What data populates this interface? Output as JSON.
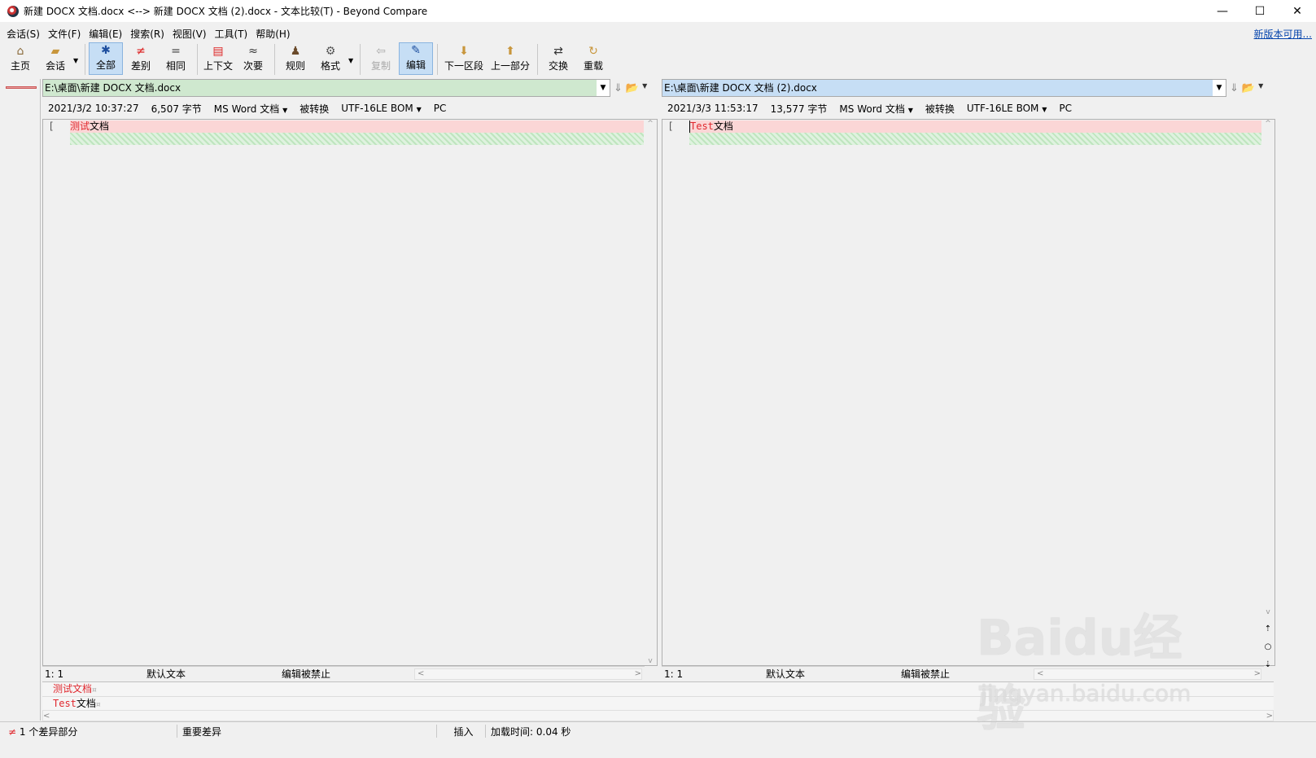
{
  "window": {
    "title": "新建 DOCX 文档.docx <--> 新建 DOCX 文档 (2).docx - 文本比较(T) - Beyond Compare",
    "minimize": "—",
    "maximize": "☐",
    "close": "✕"
  },
  "menu": {
    "items": [
      "会话(S)",
      "文件(F)",
      "编辑(E)",
      "搜索(R)",
      "视图(V)",
      "工具(T)",
      "帮助(H)"
    ],
    "new_version": "新版本可用..."
  },
  "toolbar": {
    "home": "主页",
    "session": "会话",
    "all": "全部",
    "diffs": "差别",
    "same": "相同",
    "context": "上下文",
    "minor": "次要",
    "rules": "规则",
    "format": "格式",
    "copy": "复制",
    "edit": "编辑",
    "next_section": "下一区段",
    "prev_section": "上一部分",
    "swap": "交换",
    "reload": "重载"
  },
  "left": {
    "path": "E:\\桌面\\新建 DOCX 文档.docx",
    "date": "2021/3/2 10:37:27",
    "size": "6,507 字节",
    "type": "MS Word 文档",
    "converted": "被转换",
    "encoding": "UTF-16LE BOM",
    "eol": "PC",
    "line_text_red": "测试",
    "line_text": "文档",
    "bracket": "[",
    "pos": "1: 1",
    "mode": "默认文本",
    "edit_state": "编辑被禁止"
  },
  "right": {
    "path": "E:\\桌面\\新建 DOCX 文档 (2).docx",
    "date": "2021/3/3 11:53:17",
    "size": "13,577 字节",
    "type": "MS Word 文档",
    "converted": "被转换",
    "encoding": "UTF-16LE BOM",
    "eol": "PC",
    "line_text_red": "Test",
    "line_text": "文档",
    "bracket": "[",
    "pos": "1: 1",
    "mode": "默认文本",
    "edit_state": "编辑被禁止"
  },
  "bottom": {
    "line1_red": "测试文档",
    "line1_mark": "¤",
    "line2_red": "Test",
    "line2": "文档",
    "line2_mark": "¤"
  },
  "statusbar": {
    "diff_icon": "≠",
    "diff_count": "1 个差异部分",
    "important": "重要差异",
    "insert": "插入",
    "load_label": "加载时间:",
    "load_time": "0.04 秒"
  },
  "watermark": {
    "main": "Baidu经验",
    "sub": "jingyan.baidu.com"
  }
}
